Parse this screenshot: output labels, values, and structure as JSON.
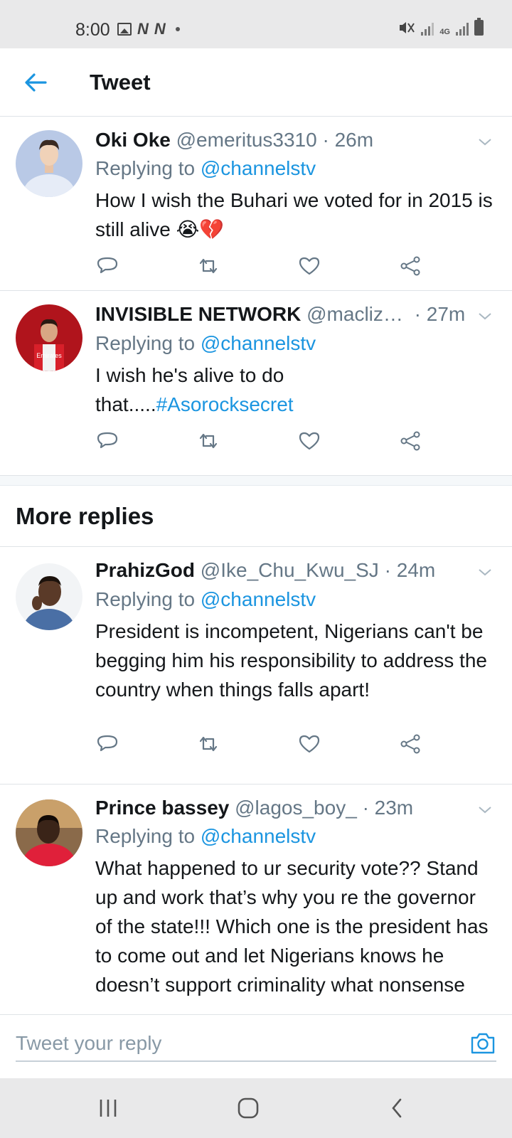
{
  "status_bar": {
    "time": "8:00",
    "network_badge": "4G",
    "icons": [
      "image-icon",
      "n-icon",
      "n-icon",
      "dot-icon",
      "mute-icon",
      "signal-icon",
      "signal-icon",
      "battery-icon"
    ]
  },
  "header": {
    "title": "Tweet",
    "back_icon": "arrow-left-icon"
  },
  "colors": {
    "accent": "#1b95e0",
    "secondary_text": "#657786",
    "primary_text": "#14171a",
    "divider": "#dfe3e7"
  },
  "tweets": [
    {
      "name": "Oki Oke",
      "handle": "@emeritus3310",
      "time": "· 26m",
      "replying_prefix": "Replying to ",
      "replying_to": "@channelstv",
      "text": "How I wish the Buhari we voted for in 2015 is still alive",
      "emoji": "😭💔"
    },
    {
      "name": "INVISIBLE NETWORK",
      "handle": "@macliz…",
      "time": "· 27m",
      "replying_prefix": "Replying to ",
      "replying_to": "@channelstv",
      "text": "I wish he's alive to do that.....",
      "hashtag": "#Asorocksecret"
    }
  ],
  "more_replies": {
    "title": "More replies",
    "items": [
      {
        "name": "PrahizGod",
        "handle": "@Ike_Chu_Kwu_SJ",
        "time": "· 24m",
        "replying_prefix": "Replying to ",
        "replying_to": "@channelstv",
        "text": "President is incompetent, Nigerians can't be begging him his responsibility to address the country when things falls apart!"
      },
      {
        "name": "Prince bassey",
        "handle": "@lagos_boy_",
        "time": "· 23m",
        "replying_prefix": "Replying to ",
        "replying_to": "@channelstv",
        "text": "What happened to ur security vote?? Stand up and work that’s why you re the governor of the state!!! Which one is the president has to come out and let Nigerians knows he doesn’t support criminality what nonsense"
      }
    ]
  },
  "reply_bar": {
    "placeholder": "Tweet your reply",
    "camera_icon": "camera-icon"
  },
  "nav_bar": {
    "icons": [
      "recent-apps-icon",
      "home-icon",
      "back-icon"
    ]
  }
}
